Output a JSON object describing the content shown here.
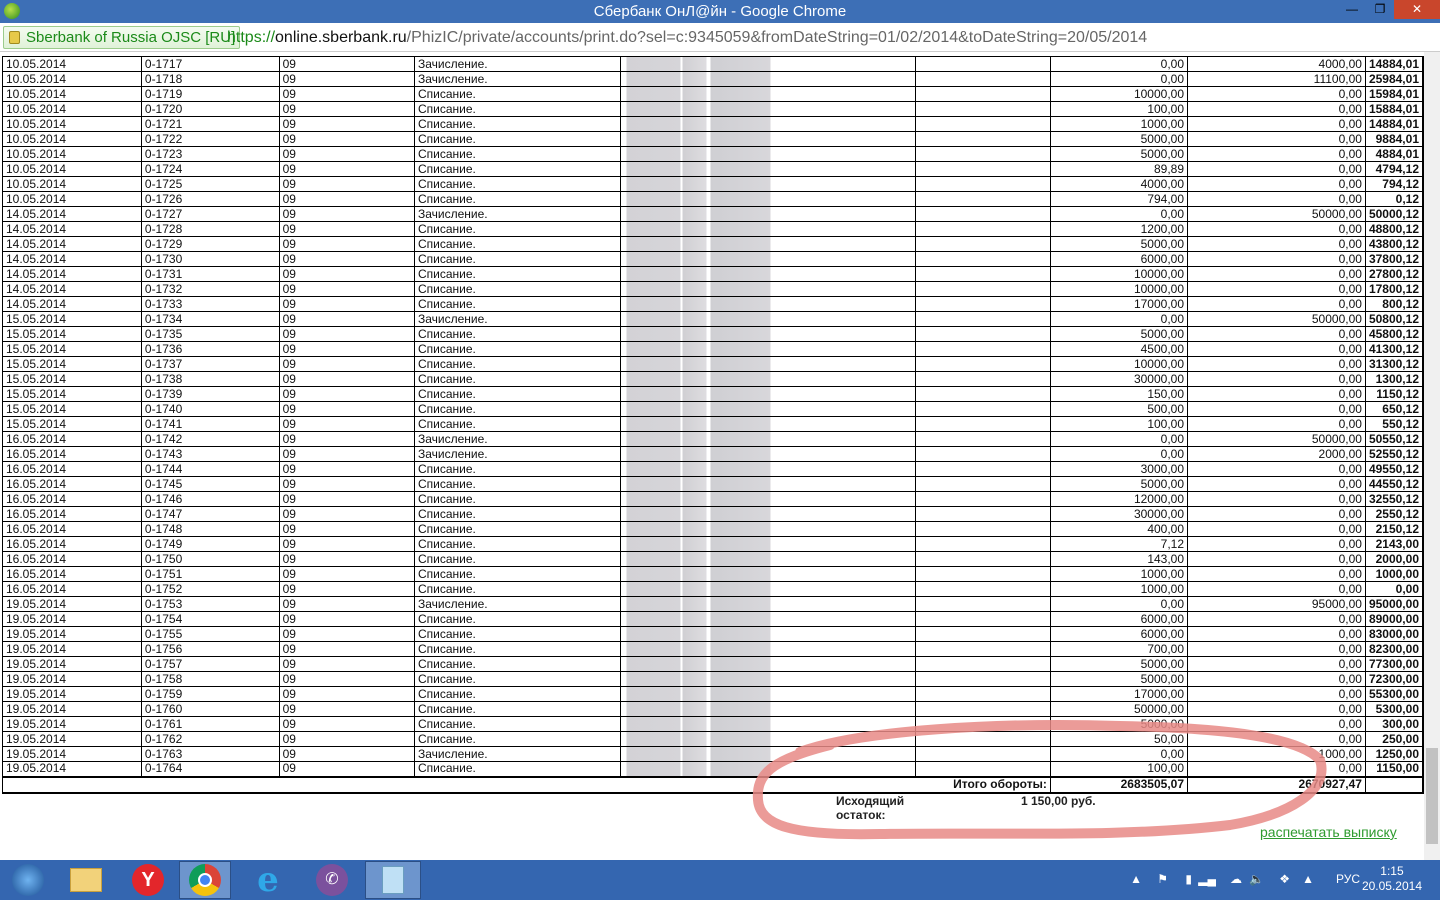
{
  "window": {
    "title": "Сбербанк ОнЛ@йн - Google Chrome"
  },
  "address": {
    "ev_label": "Sberbank of Russia OJSC [RU]",
    "scheme": "https://",
    "host": "online.sberbank.ru",
    "path": "/PhizIC/private/accounts/print.do?sel=c:9345059&fromDateString=01/02/2014&toDateString=20/05/2014"
  },
  "colors": {
    "titlebar": "#3d6fb6",
    "link": "#2e9b2e",
    "annotation": "#e88a86"
  },
  "statement": {
    "rows": [
      [
        "10.05.2014",
        "0-1717",
        "09",
        "Зачисление.",
        "0,00",
        "4000,00",
        "14884,01"
      ],
      [
        "10.05.2014",
        "0-1718",
        "09",
        "Зачисление.",
        "0,00",
        "11100,00",
        "25984,01"
      ],
      [
        "10.05.2014",
        "0-1719",
        "09",
        "Списание.",
        "10000,00",
        "0,00",
        "15984,01"
      ],
      [
        "10.05.2014",
        "0-1720",
        "09",
        "Списание.",
        "100,00",
        "0,00",
        "15884,01"
      ],
      [
        "10.05.2014",
        "0-1721",
        "09",
        "Списание.",
        "1000,00",
        "0,00",
        "14884,01"
      ],
      [
        "10.05.2014",
        "0-1722",
        "09",
        "Списание.",
        "5000,00",
        "0,00",
        "9884,01"
      ],
      [
        "10.05.2014",
        "0-1723",
        "09",
        "Списание.",
        "5000,00",
        "0,00",
        "4884,01"
      ],
      [
        "10.05.2014",
        "0-1724",
        "09",
        "Списание.",
        "89,89",
        "0,00",
        "4794,12"
      ],
      [
        "10.05.2014",
        "0-1725",
        "09",
        "Списание.",
        "4000,00",
        "0,00",
        "794,12"
      ],
      [
        "10.05.2014",
        "0-1726",
        "09",
        "Списание.",
        "794,00",
        "0,00",
        "0,12"
      ],
      [
        "14.05.2014",
        "0-1727",
        "09",
        "Зачисление.",
        "0,00",
        "50000,00",
        "50000,12"
      ],
      [
        "14.05.2014",
        "0-1728",
        "09",
        "Списание.",
        "1200,00",
        "0,00",
        "48800,12"
      ],
      [
        "14.05.2014",
        "0-1729",
        "09",
        "Списание.",
        "5000,00",
        "0,00",
        "43800,12"
      ],
      [
        "14.05.2014",
        "0-1730",
        "09",
        "Списание.",
        "6000,00",
        "0,00",
        "37800,12"
      ],
      [
        "14.05.2014",
        "0-1731",
        "09",
        "Списание.",
        "10000,00",
        "0,00",
        "27800,12"
      ],
      [
        "14.05.2014",
        "0-1732",
        "09",
        "Списание.",
        "10000,00",
        "0,00",
        "17800,12"
      ],
      [
        "14.05.2014",
        "0-1733",
        "09",
        "Списание.",
        "17000,00",
        "0,00",
        "800,12"
      ],
      [
        "15.05.2014",
        "0-1734",
        "09",
        "Зачисление.",
        "0,00",
        "50000,00",
        "50800,12"
      ],
      [
        "15.05.2014",
        "0-1735",
        "09",
        "Списание.",
        "5000,00",
        "0,00",
        "45800,12"
      ],
      [
        "15.05.2014",
        "0-1736",
        "09",
        "Списание.",
        "4500,00",
        "0,00",
        "41300,12"
      ],
      [
        "15.05.2014",
        "0-1737",
        "09",
        "Списание.",
        "10000,00",
        "0,00",
        "31300,12"
      ],
      [
        "15.05.2014",
        "0-1738",
        "09",
        "Списание.",
        "30000,00",
        "0,00",
        "1300,12"
      ],
      [
        "15.05.2014",
        "0-1739",
        "09",
        "Списание.",
        "150,00",
        "0,00",
        "1150,12"
      ],
      [
        "15.05.2014",
        "0-1740",
        "09",
        "Списание.",
        "500,00",
        "0,00",
        "650,12"
      ],
      [
        "15.05.2014",
        "0-1741",
        "09",
        "Списание.",
        "100,00",
        "0,00",
        "550,12"
      ],
      [
        "16.05.2014",
        "0-1742",
        "09",
        "Зачисление.",
        "0,00",
        "50000,00",
        "50550,12"
      ],
      [
        "16.05.2014",
        "0-1743",
        "09",
        "Зачисление.",
        "0,00",
        "2000,00",
        "52550,12"
      ],
      [
        "16.05.2014",
        "0-1744",
        "09",
        "Списание.",
        "3000,00",
        "0,00",
        "49550,12"
      ],
      [
        "16.05.2014",
        "0-1745",
        "09",
        "Списание.",
        "5000,00",
        "0,00",
        "44550,12"
      ],
      [
        "16.05.2014",
        "0-1746",
        "09",
        "Списание.",
        "12000,00",
        "0,00",
        "32550,12"
      ],
      [
        "16.05.2014",
        "0-1747",
        "09",
        "Списание.",
        "30000,00",
        "0,00",
        "2550,12"
      ],
      [
        "16.05.2014",
        "0-1748",
        "09",
        "Списание.",
        "400,00",
        "0,00",
        "2150,12"
      ],
      [
        "16.05.2014",
        "0-1749",
        "09",
        "Списание.",
        "7,12",
        "0,00",
        "2143,00"
      ],
      [
        "16.05.2014",
        "0-1750",
        "09",
        "Списание.",
        "143,00",
        "0,00",
        "2000,00"
      ],
      [
        "16.05.2014",
        "0-1751",
        "09",
        "Списание.",
        "1000,00",
        "0,00",
        "1000,00"
      ],
      [
        "16.05.2014",
        "0-1752",
        "09",
        "Списание.",
        "1000,00",
        "0,00",
        "0,00"
      ],
      [
        "19.05.2014",
        "0-1753",
        "09",
        "Зачисление.",
        "0,00",
        "95000,00",
        "95000,00"
      ],
      [
        "19.05.2014",
        "0-1754",
        "09",
        "Списание.",
        "6000,00",
        "0,00",
        "89000,00"
      ],
      [
        "19.05.2014",
        "0-1755",
        "09",
        "Списание.",
        "6000,00",
        "0,00",
        "83000,00"
      ],
      [
        "19.05.2014",
        "0-1756",
        "09",
        "Списание.",
        "700,00",
        "0,00",
        "82300,00"
      ],
      [
        "19.05.2014",
        "0-1757",
        "09",
        "Списание.",
        "5000,00",
        "0,00",
        "77300,00"
      ],
      [
        "19.05.2014",
        "0-1758",
        "09",
        "Списание.",
        "5000,00",
        "0,00",
        "72300,00"
      ],
      [
        "19.05.2014",
        "0-1759",
        "09",
        "Списание.",
        "17000,00",
        "0,00",
        "55300,00"
      ],
      [
        "19.05.2014",
        "0-1760",
        "09",
        "Списание.",
        "50000,00",
        "0,00",
        "5300,00"
      ],
      [
        "19.05.2014",
        "0-1761",
        "09",
        "Списание.",
        "5000,00",
        "0,00",
        "300,00"
      ],
      [
        "19.05.2014",
        "0-1762",
        "09",
        "Списание.",
        "50,00",
        "0,00",
        "250,00"
      ],
      [
        "19.05.2014",
        "0-1763",
        "09",
        "Зачисление.",
        "0,00",
        "1000,00",
        "1250,00"
      ],
      [
        "19.05.2014",
        "0-1764",
        "09",
        "Списание.",
        "100,00",
        "0,00",
        "1150,00"
      ]
    ],
    "totals_label": "Итого обороты:",
    "totals_debit": "2683505,07",
    "totals_credit": "2670927,47",
    "closing_label": "Исходящий остаток:",
    "closing_value": "1 150,00 руб.",
    "print_link": "распечатать выписку"
  },
  "taskbar": {
    "apps": [
      "start-icon",
      "file-explorer-icon",
      "yandex-browser-icon",
      "chrome-icon",
      "internet-explorer-icon",
      "viber-icon",
      "calculator-icon"
    ],
    "active": "chrome-icon",
    "language": "РУС",
    "time": "1:15",
    "date": "20.05.2014"
  }
}
